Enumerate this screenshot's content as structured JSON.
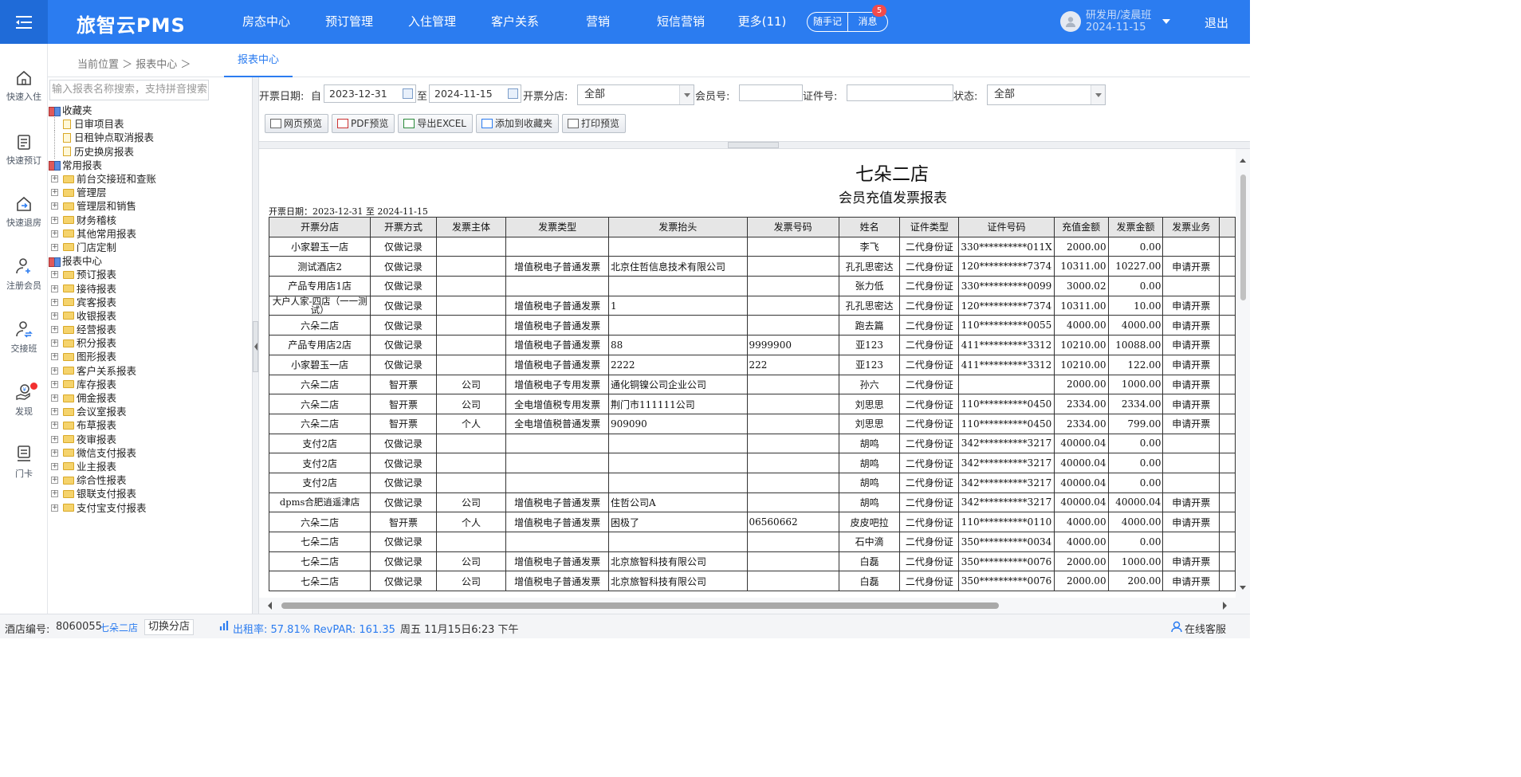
{
  "header": {
    "logo": "旅智云PMS",
    "nav": [
      "房态中心",
      "预订管理",
      "入住管理",
      "客户关系",
      "营销",
      "短信营销",
      "更多(11)"
    ],
    "pill_notes": "随手记",
    "pill_messages": "消息",
    "message_count": "5",
    "user_name": "研发用/凌晨班",
    "user_date": "2024-11-15",
    "logout": "退出"
  },
  "sidebar": {
    "items": [
      {
        "label": "快速入住",
        "icon": "home-icon"
      },
      {
        "label": "快速预订",
        "icon": "clipboard-icon"
      },
      {
        "label": "快速退房",
        "icon": "checkout-icon"
      },
      {
        "label": "注册会员",
        "icon": "add-user-icon"
      },
      {
        "label": "交接班",
        "icon": "shift-handover-icon"
      },
      {
        "label": "发现",
        "icon": "discover-icon"
      },
      {
        "label": "门卡",
        "icon": "card-icon"
      }
    ]
  },
  "breadcrumb": {
    "text": "当前位置 ＞ 报表中心 ＞",
    "active_tab": "报表中心"
  },
  "tree": {
    "search_placeholder": "输入报表名称搜索，支持拼音搜索",
    "groups": [
      {
        "label": "收藏夹",
        "children": [
          "日审项目表",
          "日租钟点取消报表",
          "历史换房报表"
        ]
      },
      {
        "label": "常用报表",
        "children": [
          "前台交接班和查账",
          "管理层",
          "管理层和销售",
          "财务稽核",
          "其他常用报表",
          "门店定制"
        ]
      },
      {
        "label": "报表中心",
        "children": [
          "预订报表",
          "接待报表",
          "宾客报表",
          "收银报表",
          "经营报表",
          "积分报表",
          "图形报表",
          "客户关系报表",
          "库存报表",
          "佣金报表",
          "会议室报表",
          "布草报表",
          "夜审报表",
          "微信支付报表",
          "业主报表",
          "综合性报表",
          "银联支付报表",
          "支付宝支付报表"
        ]
      }
    ]
  },
  "filters": {
    "date_label": "开票日期:",
    "from_label": "自",
    "from_value": "2023-12-31",
    "to_label": "至",
    "to_value": "2024-11-15",
    "branch_label": "开票分店:",
    "branch_value": "全部",
    "member_label": "会员号:",
    "member_value": "",
    "id_label": "证件号:",
    "id_value": "",
    "status_label": "状态:",
    "status_value": "全部"
  },
  "toolbar": {
    "web_preview": "网页预览",
    "pdf_preview": "PDF预览",
    "export_excel": "导出EXCEL",
    "add_favorite": "添加到收藏夹",
    "print_preview": "打印预览"
  },
  "report": {
    "hotel": "七朵二店",
    "title": "会员充值发票报表",
    "date_range": "开票日期：2023-12-31 至 2024-11-15",
    "columns": [
      "开票分店",
      "开票方式",
      "发票主体",
      "发票类型",
      "发票抬头",
      "发票号码",
      "姓名",
      "证件类型",
      "证件号码",
      "充值金额",
      "发票金额",
      "发票业务"
    ],
    "rows": [
      [
        "小家碧玉一店",
        "仅做记录",
        "",
        "",
        "",
        "",
        "李飞",
        "二代身份证",
        "330**********011X",
        "2000.00",
        "0.00",
        ""
      ],
      [
        "测试酒店2",
        "仅做记录",
        "",
        "增值税电子普通发票",
        "北京住哲信息技术有限公司",
        "",
        "孔孔思密达",
        "二代身份证",
        "120**********7374",
        "10311.00",
        "10227.00",
        "申请开票"
      ],
      [
        "产品专用店1店",
        "仅做记录",
        "",
        "",
        "",
        "",
        "张力低",
        "二代身份证",
        "330**********0099",
        "3000.02",
        "0.00",
        ""
      ],
      [
        "大户人家-四店（一一测试）",
        "仅做记录",
        "",
        "增值税电子普通发票",
        "1",
        "",
        "孔孔思密达",
        "二代身份证",
        "120**********7374",
        "10311.00",
        "10.00",
        "申请开票"
      ],
      [
        "六朵二店",
        "仅做记录",
        "",
        "增值税电子普通发票",
        "",
        "",
        "跑去篇",
        "二代身份证",
        "110**********0055",
        "4000.00",
        "4000.00",
        "申请开票"
      ],
      [
        "产品专用店2店",
        "仅做记录",
        "",
        "增值税电子普通发票",
        "88",
        "9999900",
        "亚123",
        "二代身份证",
        "411**********3312",
        "10210.00",
        "10088.00",
        "申请开票"
      ],
      [
        "小家碧玉一店",
        "仅做记录",
        "",
        "增值税电子普通发票",
        "2222",
        "222",
        "亚123",
        "二代身份证",
        "411**********3312",
        "10210.00",
        "122.00",
        "申请开票"
      ],
      [
        "六朵二店",
        "智开票",
        "公司",
        "增值税电子专用发票",
        "通化铜镍公司企业公司",
        "",
        "孙六",
        "二代身份证",
        "",
        "2000.00",
        "1000.00",
        "申请开票"
      ],
      [
        "六朵二店",
        "智开票",
        "公司",
        "全电增值税专用发票",
        "荆门市111111公司",
        "",
        "刘思思",
        "二代身份证",
        "110**********0450",
        "2334.00",
        "2334.00",
        "申请开票"
      ],
      [
        "六朵二店",
        "智开票",
        "个人",
        "全电增值税普通发票",
        "909090",
        "",
        "刘思思",
        "二代身份证",
        "110**********0450",
        "2334.00",
        "799.00",
        "申请开票"
      ],
      [
        "支付2店",
        "仅做记录",
        "",
        "",
        "",
        "",
        "胡鸣",
        "二代身份证",
        "342**********3217",
        "40000.04",
        "0.00",
        ""
      ],
      [
        "支付2店",
        "仅做记录",
        "",
        "",
        "",
        "",
        "胡鸣",
        "二代身份证",
        "342**********3217",
        "40000.04",
        "0.00",
        ""
      ],
      [
        "支付2店",
        "仅做记录",
        "",
        "",
        "",
        "",
        "胡鸣",
        "二代身份证",
        "342**********3217",
        "40000.04",
        "0.00",
        ""
      ],
      [
        "dpms合肥逍遥津店",
        "仅做记录",
        "公司",
        "增值税电子普通发票",
        "住哲公司A",
        "",
        "胡鸣",
        "二代身份证",
        "342**********3217",
        "40000.04",
        "40000.04",
        "申请开票"
      ],
      [
        "六朵二店",
        "智开票",
        "个人",
        "增值税电子普通发票",
        "困极了",
        "06560662",
        "皮皮吧拉",
        "二代身份证",
        "110**********0110",
        "4000.00",
        "4000.00",
        "申请开票"
      ],
      [
        "七朵二店",
        "仅做记录",
        "",
        "",
        "",
        "",
        "石中滴",
        "二代身份证",
        "350**********0034",
        "4000.00",
        "0.00",
        ""
      ],
      [
        "七朵二店",
        "仅做记录",
        "公司",
        "增值税电子普通发票",
        "北京旅智科技有限公司",
        "",
        "白磊",
        "二代身份证",
        "350**********0076",
        "2000.00",
        "1000.00",
        "申请开票"
      ],
      [
        "七朵二店",
        "仅做记录",
        "公司",
        "增值税电子普通发票",
        "北京旅智科技有限公司",
        "",
        "白磊",
        "二代身份证",
        "350**********0076",
        "2000.00",
        "200.00",
        "申请开票"
      ]
    ]
  },
  "statusbar": {
    "hotel_no_label": "酒店编号:",
    "hotel_no": "8060055",
    "store": "七朵二店",
    "switch_store": "切换分店",
    "occupancy": "出租率: 57.81% RevPAR: 161.35",
    "datetime": "周五 11月15日6:23 下午",
    "online_service": "在线客服"
  }
}
